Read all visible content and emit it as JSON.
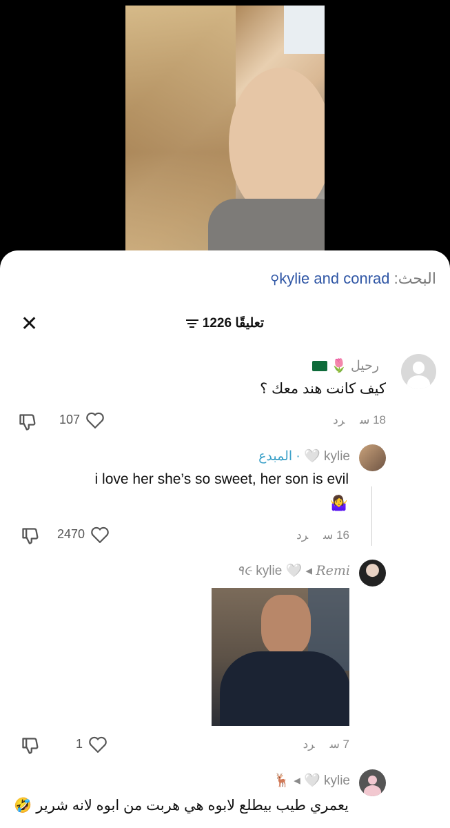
{
  "search": {
    "label": "البحث:",
    "query": "kylie and conrad",
    "icon": "search-icon"
  },
  "header": {
    "count_label": "1226 تعليقًا",
    "close_icon": "close-icon",
    "filter_icon": "filter-icon"
  },
  "comments": [
    {
      "name": "رحيل 🌷",
      "text": "كيف كانت هند معك ؟",
      "time": "18 س",
      "reply": "رد",
      "likes": "107"
    },
    {
      "name": "kylie 🤍",
      "badge": "· المبدع",
      "text": "i love her she’s so sweet, her son is evil",
      "emoji": "🤷‍♀️",
      "time": "16 س",
      "reply": "رد",
      "likes": "2470"
    },
    {
      "name": "Remi ٩૯",
      "reply_to": "kylie 🤍",
      "arrow": "◂",
      "time": "7 س",
      "reply": "رد",
      "likes": "1"
    },
    {
      "name": "🦌",
      "reply_to": "kylie 🤍",
      "arrow": "◂",
      "text": "يعمري طيب بيطلع لابوه هي هربت من ابوه لانه شرير 🤣"
    }
  ],
  "colors": {
    "accent_blue": "#2f56a5",
    "muted": "#8a8a8a",
    "creator": "#3aa0c8"
  }
}
